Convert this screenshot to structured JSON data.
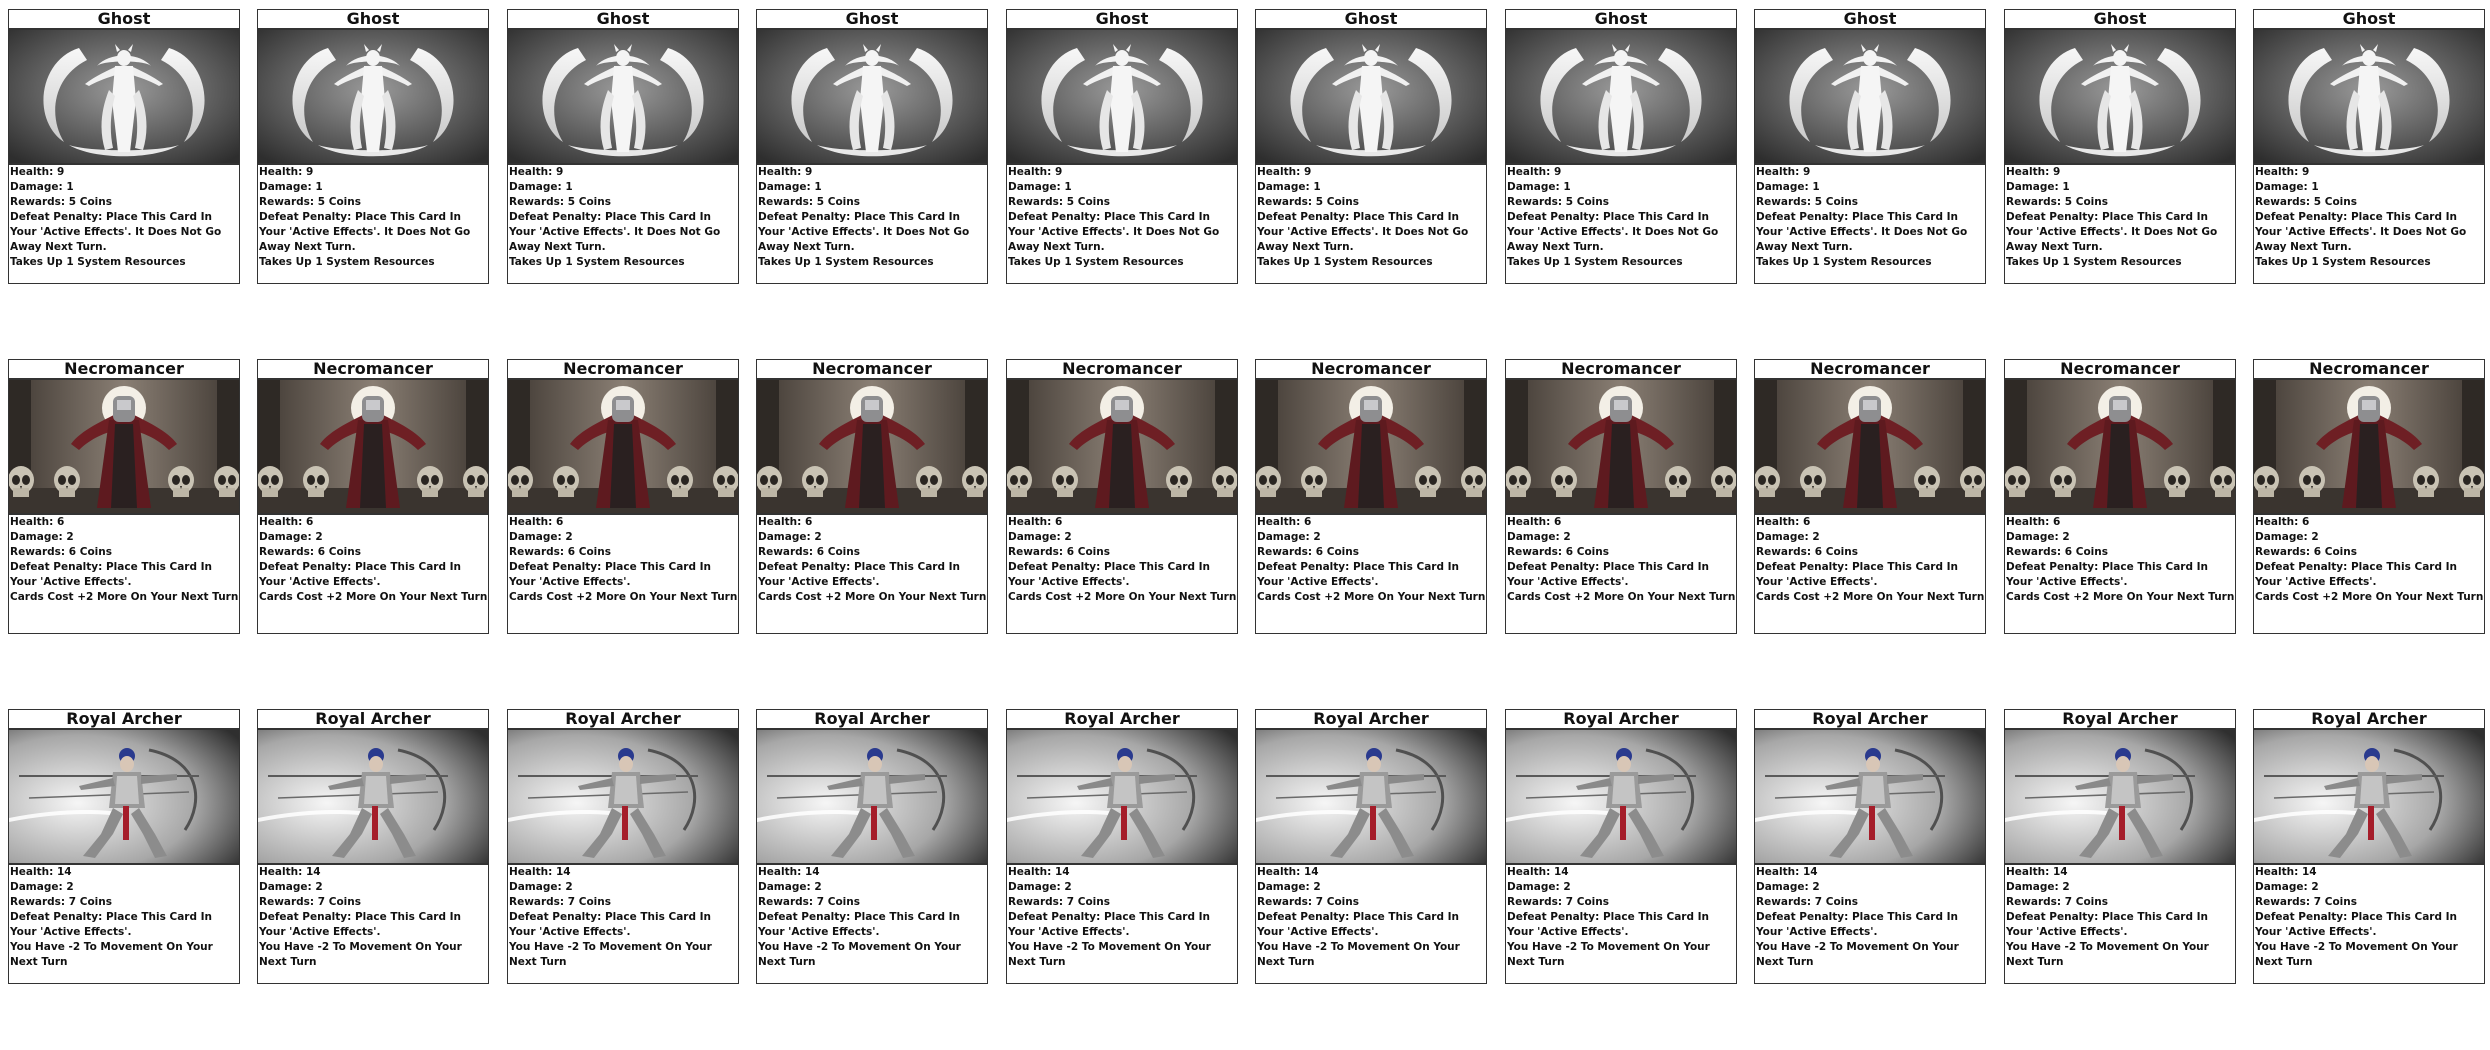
{
  "card_types": [
    {
      "name": "Ghost",
      "art": "ghost-illustration",
      "stats": [
        "Health: 9",
        "Damage: 1",
        "Rewards: 5 Coins"
      ],
      "penalty": "Defeat Penalty: Place This Card In Your 'Active Effects'. It Does Not Go Away Next Turn.",
      "effect": "Takes Up 1 System Resources",
      "copies": 10
    },
    {
      "name": "Necromancer",
      "art": "necromancer-illustration",
      "stats": [
        "Health: 6",
        "Damage: 2",
        "Rewards: 6 Coins"
      ],
      "penalty": "Defeat Penalty: Place This Card In Your 'Active Effects'.",
      "effect": "Cards Cost +2 More On Your Next Turn",
      "copies": 10
    },
    {
      "name": "Royal Archer",
      "art": "archer-illustration",
      "stats": [
        "Health: 14",
        "Damage: 2",
        "Rewards: 7 Coins"
      ],
      "penalty": "Defeat Penalty: Place This Card In Your 'Active Effects'.",
      "effect": "You Have -2 To Movement On Your Next Turn",
      "copies": 10
    }
  ],
  "colors": {
    "border": "#333333",
    "ghost_bg_light": "#8a8a8a",
    "ghost_bg_dark": "#2e2e2e",
    "necro_bg": "#5a4e46",
    "necro_robe": "#6e1f24",
    "archer_bg_light": "#f2f2f2",
    "archer_bg_dark": "#303030"
  }
}
